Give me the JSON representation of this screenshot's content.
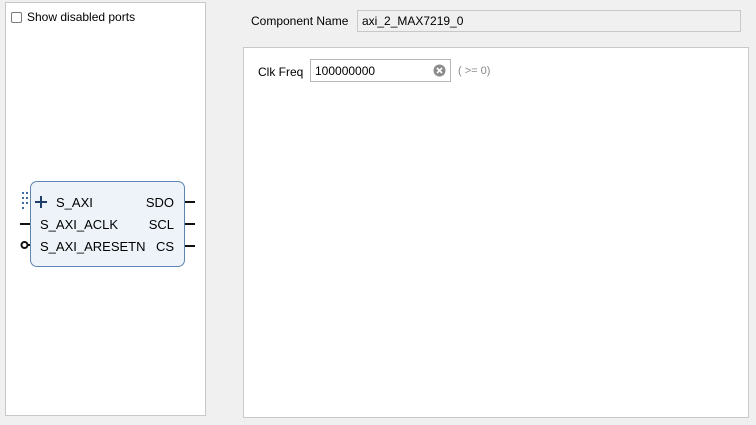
{
  "symbol_panel": {
    "show_disabled_ports_label": "Show disabled ports",
    "show_disabled_ports_checked": false,
    "block": {
      "left_ports": [
        "S_AXI",
        "S_AXI_ACLK",
        "S_AXI_ARESETN"
      ],
      "right_ports": [
        "SDO",
        "SCL",
        "CS"
      ],
      "icons": {
        "s_axi": "plus-icon",
        "aresetn": "active-low-bubble-icon"
      }
    }
  },
  "component": {
    "label": "Component Name",
    "value": "axi_2_MAX7219_0"
  },
  "params": {
    "clk_freq": {
      "label": "Clk Freq",
      "value": "100000000",
      "hint": "( >= 0)"
    }
  },
  "colors": {
    "block_border": "#5c86b0",
    "block_fill": "#eef3f9",
    "panel_border": "#c8c8c8",
    "background": "#f0f0f0"
  }
}
